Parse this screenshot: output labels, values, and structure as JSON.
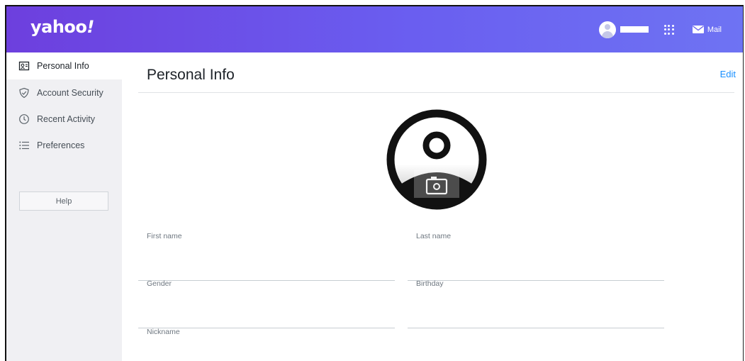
{
  "header": {
    "logo_text": "yahoo",
    "logo_bang": "!",
    "mail_label": "Mail",
    "brand_gradient": [
      "#6d3fde",
      "#6e73f3"
    ]
  },
  "sidebar": {
    "items": [
      {
        "label": "Personal Info",
        "icon": "id-card-icon",
        "active": true
      },
      {
        "label": "Account Security",
        "icon": "shield-icon",
        "active": false
      },
      {
        "label": "Recent Activity",
        "icon": "clock-icon",
        "active": false
      },
      {
        "label": "Preferences",
        "icon": "list-icon",
        "active": false
      }
    ],
    "help_label": "Help"
  },
  "main": {
    "title": "Personal Info",
    "edit_label": "Edit",
    "fields": {
      "first_name": {
        "label": "First name",
        "value": ""
      },
      "last_name": {
        "label": "Last name",
        "value": ""
      },
      "gender": {
        "label": "Gender",
        "value": ""
      },
      "birthday": {
        "label": "Birthday",
        "value": ""
      },
      "nickname": {
        "label": "Nickname",
        "value": ""
      }
    }
  },
  "colors": {
    "accent_link": "#188fff",
    "sidebar_bg": "#f0f0f3"
  }
}
